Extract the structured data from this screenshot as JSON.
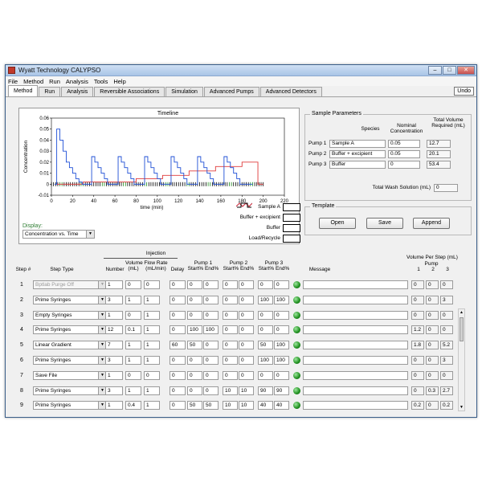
{
  "window": {
    "title": "Wyatt Technology CALYPSO",
    "controls": [
      "–",
      "□",
      "✕"
    ]
  },
  "menu": [
    "File",
    "Method",
    "Run",
    "Analysis",
    "Tools",
    "Help"
  ],
  "tabs": [
    "Method",
    "Run",
    "Analysis",
    "Reversible Associations",
    "Simulation",
    "Advanced Pumps",
    "Advanced Detectors"
  ],
  "active_tab": "Method",
  "undo_label": "Undo",
  "chart_data": {
    "type": "line",
    "title": "Timeline",
    "xlabel": "time (min)",
    "ylabel": "Concentration",
    "xlim": [
      0,
      220
    ],
    "ylim": [
      -0.01,
      0.06
    ],
    "xticks": [
      0,
      20,
      40,
      60,
      80,
      100,
      120,
      140,
      160,
      180,
      200,
      220
    ],
    "yticks": [
      -0.01,
      0,
      0.01,
      0.02,
      0.03,
      0.04,
      0.05,
      0.06
    ],
    "series": [
      {
        "name": "Sample A",
        "color": "#1f4fd6",
        "x": [
          3,
          5,
          5,
          8,
          8,
          11,
          11,
          14,
          14,
          17,
          17,
          20,
          20,
          23,
          23,
          26,
          26,
          29,
          29,
          38,
          38,
          41,
          41,
          44,
          44,
          47,
          47,
          50,
          50,
          53,
          53,
          63,
          63,
          66,
          66,
          69,
          69,
          72,
          72,
          75,
          75,
          78,
          78,
          88,
          88,
          91,
          91,
          94,
          94,
          97,
          97,
          100,
          100,
          103,
          103,
          113,
          113,
          116,
          116,
          119,
          119,
          122,
          122,
          125,
          125,
          128,
          128,
          138,
          138,
          141,
          141,
          144,
          144,
          147,
          147,
          150,
          150,
          153,
          153,
          163,
          163,
          166,
          166,
          169,
          169,
          172,
          172,
          175,
          175,
          178,
          178,
          190
        ],
        "y": [
          0,
          0,
          0.05,
          0.05,
          0.04,
          0.04,
          0.03,
          0.03,
          0.02,
          0.02,
          0.015,
          0.015,
          0.01,
          0.01,
          0.005,
          0.005,
          0.002,
          0.002,
          0,
          0,
          0.025,
          0.025,
          0.02,
          0.02,
          0.015,
          0.015,
          0.01,
          0.01,
          0.005,
          0.005,
          0,
          0,
          0.025,
          0.025,
          0.02,
          0.02,
          0.015,
          0.015,
          0.01,
          0.01,
          0.005,
          0.005,
          0,
          0,
          0.025,
          0.025,
          0.02,
          0.02,
          0.015,
          0.015,
          0.01,
          0.01,
          0.005,
          0.005,
          0,
          0,
          0.025,
          0.025,
          0.02,
          0.02,
          0.015,
          0.015,
          0.01,
          0.01,
          0.005,
          0.005,
          0,
          0,
          0.025,
          0.025,
          0.02,
          0.02,
          0.015,
          0.015,
          0.01,
          0.01,
          0.005,
          0.005,
          0,
          0,
          0.025,
          0.025,
          0.02,
          0.02,
          0.015,
          0.015,
          0.01,
          0.01,
          0.005,
          0.005,
          0,
          0
        ]
      },
      {
        "name": "Buffer + excipient",
        "color": "#e03a3a",
        "x": [
          5,
          30,
          30,
          80,
          80,
          105,
          105,
          130,
          130,
          155,
          155,
          180,
          180,
          195,
          195,
          200
        ],
        "y": [
          0,
          0,
          0.002,
          0.002,
          0.005,
          0.005,
          0.008,
          0.008,
          0.012,
          0.012,
          0.016,
          0.016,
          0.02,
          0.02,
          0,
          0
        ]
      },
      {
        "name": "Buffer",
        "color": "#1a8a1a",
        "x": [
          0,
          200
        ],
        "y": [
          0,
          0
        ]
      },
      {
        "name": "Load/Recycle",
        "color": "#000000",
        "x": [
          0,
          200
        ],
        "y": [
          -0.002,
          -0.002
        ]
      }
    ]
  },
  "display": {
    "label": "Display:",
    "value": "Concentration vs. Time"
  },
  "sample_params": {
    "title": "Sample Parameters",
    "headers": {
      "species": "Species",
      "nominal": "Nominal Concentration",
      "total": "Total Volume Required (mL)"
    },
    "rows": [
      {
        "label": "Pump 1",
        "species": "Sample A",
        "nominal": "0.05",
        "total": "12.7"
      },
      {
        "label": "Pump 2",
        "species": "Buffer + excipient",
        "nominal": "0.05",
        "total": "20.1"
      },
      {
        "label": "Pump 3",
        "species": "Buffer",
        "nominal": "0",
        "total": "53.4"
      }
    ],
    "wash_label": "Total Wash Solution (mL)",
    "wash_value": "0"
  },
  "template": {
    "title": "Template",
    "open": "Open",
    "save": "Save",
    "append": "Append"
  },
  "steps_header": {
    "step": "Step #",
    "type": "Step Type",
    "injection": "Injection",
    "number": "Number",
    "volume": "Volume (mL)",
    "flow": "Flow Rate (mL/min)",
    "delay": "Delay",
    "pump1": "Pump 1 Start% End%",
    "pump2": "Pump 2 Start% End%",
    "pump3": "Pump 3 Start% End%",
    "message": "Message",
    "vol_per_step": "Volume Per Step (mL)",
    "vol_pump": "Pump",
    "pump_cols": [
      "1",
      "2",
      "3"
    ]
  },
  "steps": [
    {
      "num": "1",
      "type": "Bptlab Purge Off",
      "disabled": true,
      "inj": [
        "1",
        "0",
        "0",
        "0"
      ],
      "p": [
        "0",
        "0",
        "0",
        "0",
        "0",
        "0"
      ],
      "v": [
        "0",
        "0",
        "0"
      ]
    },
    {
      "num": "2",
      "type": "Prime Syringes",
      "inj": [
        "3",
        "1",
        "1",
        "0"
      ],
      "p": [
        "0",
        "0",
        "0",
        "0",
        "100",
        "100"
      ],
      "v": [
        "0",
        "0",
        "3"
      ]
    },
    {
      "num": "3",
      "type": "Empty Syringes",
      "inj": [
        "1",
        "0",
        "1",
        "0"
      ],
      "p": [
        "0",
        "0",
        "0",
        "0",
        "0",
        "0"
      ],
      "v": [
        "0",
        "0",
        "0"
      ]
    },
    {
      "num": "4",
      "type": "Prime Syringes",
      "inj": [
        "12",
        "0.1",
        "1",
        "0"
      ],
      "p": [
        "100",
        "100",
        "0",
        "0",
        "0",
        "0"
      ],
      "v": [
        "1.2",
        "0",
        "0"
      ]
    },
    {
      "num": "5",
      "type": "Linear Gradient",
      "inj": [
        "7",
        "1",
        "1",
        "60"
      ],
      "p": [
        "50",
        "0",
        "0",
        "0",
        "50",
        "100"
      ],
      "v": [
        "1.8",
        "0",
        "5.2"
      ]
    },
    {
      "num": "6",
      "type": "Prime Syringes",
      "inj": [
        "3",
        "1",
        "1",
        "0"
      ],
      "p": [
        "0",
        "0",
        "0",
        "0",
        "100",
        "100"
      ],
      "v": [
        "0",
        "0",
        "3"
      ]
    },
    {
      "num": "7",
      "type": "Save File",
      "inj": [
        "1",
        "0",
        "0",
        "0"
      ],
      "p": [
        "0",
        "0",
        "0",
        "0",
        "0",
        "0"
      ],
      "v": [
        "0",
        "0",
        "0"
      ]
    },
    {
      "num": "8",
      "type": "Prime Syringes",
      "inj": [
        "3",
        "1",
        "1",
        "0"
      ],
      "p": [
        "0",
        "0",
        "10",
        "10",
        "90",
        "90"
      ],
      "v": [
        "0",
        "0.3",
        "2.7"
      ]
    },
    {
      "num": "9",
      "type": "Prime Syringes",
      "inj": [
        "1",
        "0.4",
        "1",
        "0"
      ],
      "p": [
        "50",
        "50",
        "10",
        "10",
        "40",
        "40"
      ],
      "v": [
        "0.2",
        "0",
        "0.2"
      ]
    }
  ]
}
